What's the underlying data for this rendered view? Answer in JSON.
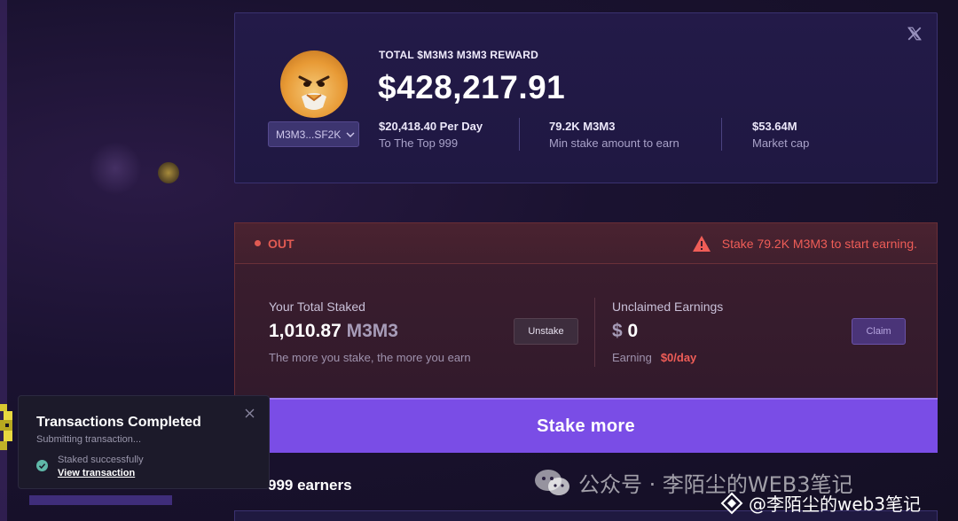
{
  "reward": {
    "label": "TOTAL $M3M3 M3M3 REWARD",
    "value": "$428,217.91",
    "token_select": "M3M3...SF2K",
    "stats": [
      {
        "value": "$20,418.40 Per Day",
        "label": "To The Top 999"
      },
      {
        "value": "79.2K M3M3",
        "label": "Min stake amount to earn"
      },
      {
        "value": "$53.64M",
        "label": "Market cap"
      }
    ]
  },
  "staking": {
    "status": "OUT",
    "warning": "Stake 79.2K M3M3 to start earning.",
    "total_staked_title": "Your Total Staked",
    "total_staked_amount": "1,010.87",
    "total_staked_unit": "M3M3",
    "total_staked_hint": "The more you stake, the more you earn",
    "unstake_label": "Unstake",
    "unclaimed_title": "Unclaimed Earnings",
    "unclaimed_currency": "$",
    "unclaimed_value": "0",
    "earning_label": "Earning",
    "earning_rate": "$0/day",
    "claim_label": "Claim"
  },
  "stake_more_label": "Stake more",
  "earners_label": "999 earners",
  "toast": {
    "title": "Transactions Completed",
    "subtitle": "Submitting transaction...",
    "status": "Staked successfully",
    "link": "View transaction"
  },
  "watermark": {
    "text": "公众号 · 李陌尘的WEB3笔记",
    "text2": "@李陌尘的web3笔记"
  },
  "colors": {
    "accent": "#7a4de6",
    "danger": "#ef5d57",
    "card": "#231a48"
  },
  "icons": [
    "x-logo-icon",
    "chevron-down-icon",
    "warning-icon",
    "close-icon",
    "check-circle-icon",
    "wechat-icon"
  ]
}
